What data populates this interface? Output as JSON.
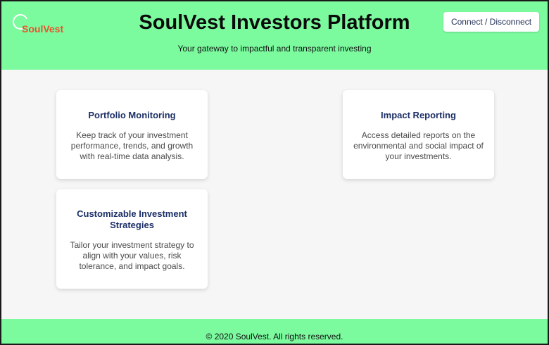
{
  "header": {
    "logo_text": "SoulVest",
    "title": "SoulVest Investors Platform",
    "subtitle": "Your gateway to impactful and transparent investing",
    "connect_label": "Connect / Disconnect"
  },
  "features": [
    {
      "title": "Portfolio Monitoring",
      "description": "Keep track of your investment performance, trends, and growth with real-time data analysis."
    },
    {
      "title": "Impact Reporting",
      "description": "Access detailed reports on the environmental and social impact of your investments."
    },
    {
      "title": "Customizable Investment Strategies",
      "description": "Tailor your investment strategy to align with your values, risk tolerance, and impact goals."
    }
  ],
  "footer": {
    "text": "© 2020 SoulVest. All rights reserved."
  },
  "colors": {
    "header_bg": "#7bfa9e",
    "logo_text": "#e8542c",
    "card_title": "#1c2f66",
    "page_bg": "#f6f6f6"
  }
}
